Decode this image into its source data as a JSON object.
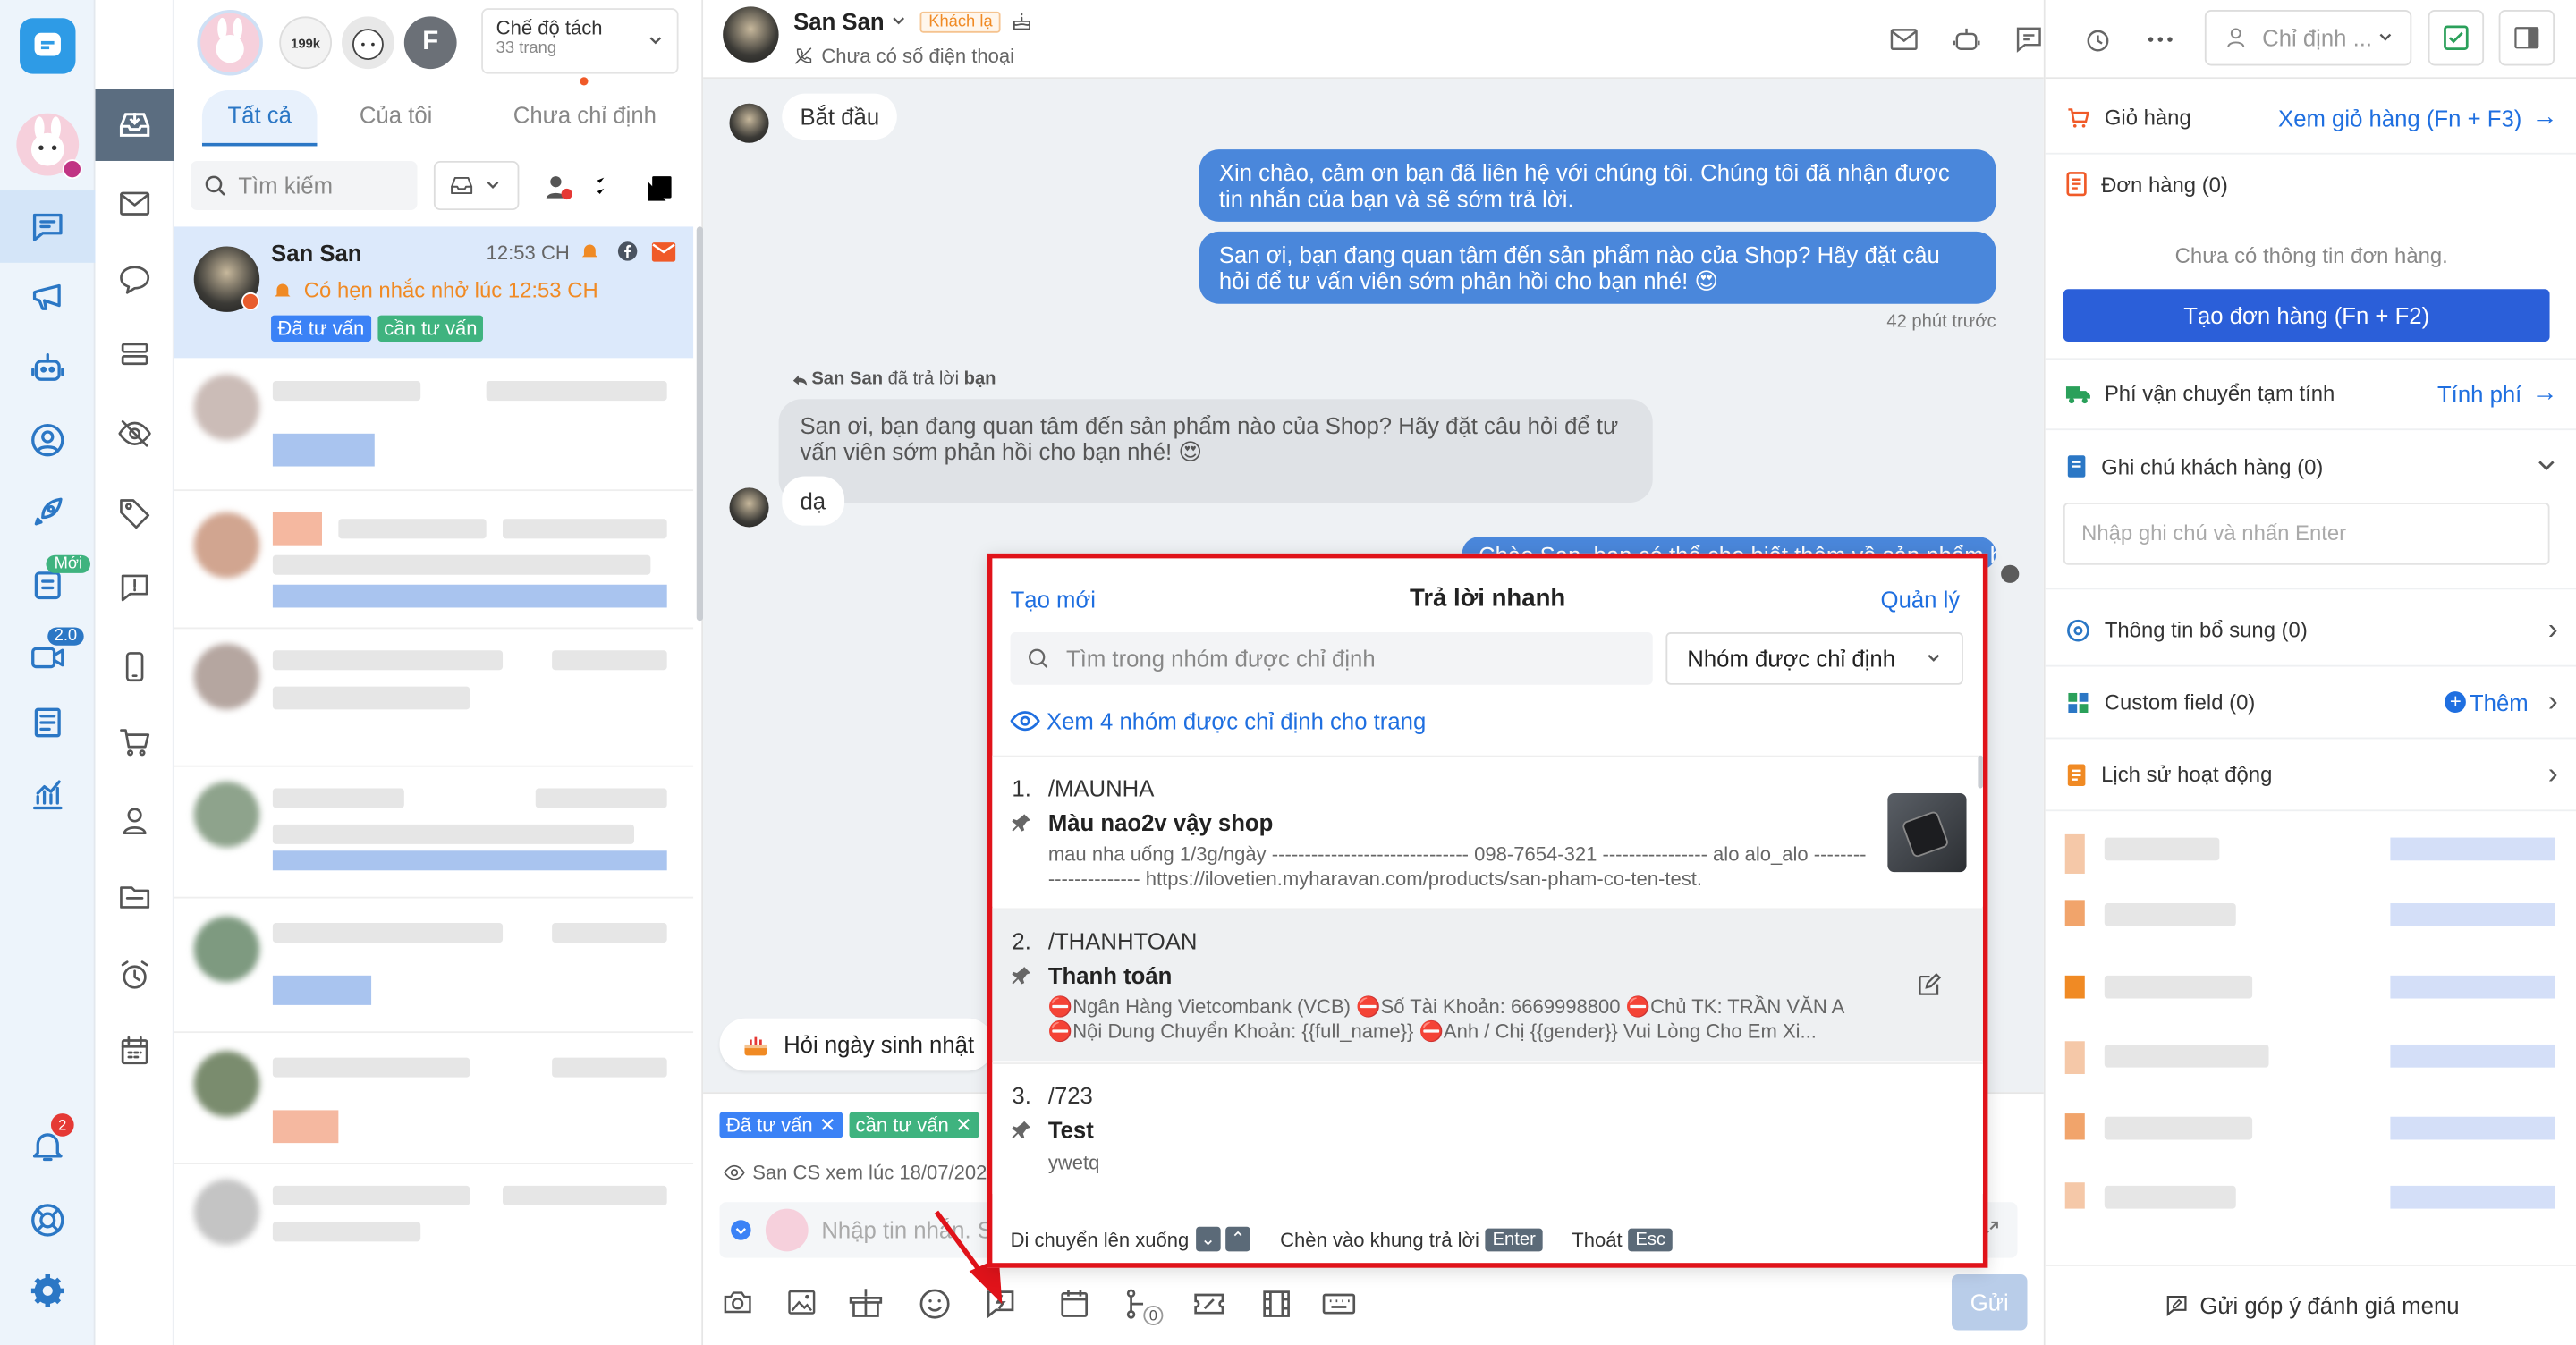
{
  "rail": {
    "badges": {
      "new": "Mới",
      "version": "2.0",
      "notifications": "2"
    }
  },
  "list": {
    "mode_label": "Chế độ tách",
    "mode_sub": "33 trang",
    "avatar_letter": "F",
    "tabs": [
      {
        "label": "Tất cả"
      },
      {
        "label": "Của tôi"
      },
      {
        "label": "Chưa chỉ định"
      }
    ],
    "search_placeholder": "Tìm kiếm",
    "active_conv": {
      "name": "San San",
      "time": "12:53 CH",
      "reminder": "Có hẹn nhắc nhở lúc 12:53 CH",
      "tags": [
        "Đã tư vấn",
        "cần tư vấn"
      ]
    }
  },
  "chat": {
    "contact_name": "San San",
    "contact_badge": "Khách lạ",
    "phone_status": "Chưa có số điện thoại",
    "assign_placeholder": "Chỉ định ...",
    "messages": {
      "start": "Bắt đầu",
      "out1": "Xin chào, cảm ơn bạn đã liên hệ với chúng tôi. Chúng tôi đã nhận được tin nhắn của bạn và sẽ sớm trả lời.",
      "out2": "San ơi, bạn đang quan tâm đến sản phẩm nào của Shop? Hãy đặt câu hỏi để tư vấn viên sớm phản hồi cho bạn nhé! 😍",
      "out_time": "42 phút trước",
      "reply_meta_name": "San San",
      "reply_meta_text": "đã trả lời",
      "reply_meta_target": "bạn",
      "quoted": "San ơi, bạn đang quan tâm đến sản phẩm nào của Shop? Hãy đặt câu hỏi để tư vấn viên sớm phản hồi cho bạn nhé! 😍",
      "in1": "dạ",
      "out3_partial": "Chào San, bạn có thể cho biết thêm về sản phẩm bạn cần?"
    },
    "birthday_chip": "Hỏi ngày sinh nhật",
    "conv_tags": [
      "Đã tư vấn",
      "cần tư vấn"
    ],
    "seen_text": "San CS xem lúc 18/07/202",
    "composer_placeholder": "Nhập tin nhắn. Sh",
    "send_label": "Gửi",
    "sticker_count": "0"
  },
  "quick_reply": {
    "create_label": "Tạo mới",
    "title": "Trả lời nhanh",
    "manage_label": "Quản lý",
    "search_placeholder": "Tìm trong nhóm được chỉ định",
    "group_select": "Nhóm được chỉ định",
    "view_groups": "Xem 4 nhóm được chỉ định cho trang",
    "items": [
      {
        "index": "1.",
        "shortcut": "/MAUNHA",
        "title": "Màu nao2v vậy shop",
        "content": "mau nha uống 1/3g/ngày ------------------------------ 098-7654-321 ---------------- alo alo_alo ---------------------- https://ilovetien.myharavan.com/products/san-pham-co-ten-test."
      },
      {
        "index": "2.",
        "shortcut": "/THANHTOAN",
        "title": "Thanh toán",
        "content": "⛔Ngân Hàng Vietcombank (VCB) ⛔Số Tài Khoản: 6669998800 ⛔Chủ TK: TRẦN VĂN A ⛔Nội Dung Chuyển Khoản: {{full_name}} ⛔Anh / Chị {{gender}} Vui Lòng Cho Em Xi..."
      },
      {
        "index": "3.",
        "shortcut": "/723",
        "title": "Test",
        "content": "ywetq"
      }
    ],
    "footer": {
      "move": "Di chuyển lên xuống",
      "insert": "Chèn vào khung trả lời",
      "insert_key": "Enter",
      "exit": "Thoát",
      "exit_key": "Esc"
    }
  },
  "right_panel": {
    "cart_label": "Giỏ hàng",
    "cart_link": "Xem giỏ hàng (Fn + F3)",
    "orders_label": "Đơn hàng (0)",
    "no_orders": "Chưa có thông tin đơn hàng.",
    "create_order": "Tạo đơn hàng (Fn + F2)",
    "shipping_label": "Phí vận chuyển tạm tính",
    "shipping_link": "Tính phí",
    "notes_label": "Ghi chú khách hàng (0)",
    "notes_placeholder": "Nhập ghi chú và nhấn Enter",
    "extra_label": "Thông tin bổ sung (0)",
    "custom_label": "Custom field (0)",
    "custom_add": "Thêm",
    "history_label": "Lịch sử hoạt động",
    "feedback": "Gửi góp ý đánh giá menu"
  },
  "colors": {
    "primary": "#2b5fd9",
    "link": "#1f6fe0",
    "rail_bg": "#edf4fb",
    "active_conv_bg": "#dce9fb",
    "highlight_border": "#e0131a",
    "tag_blue": "#3b82f6",
    "tag_green": "#3fb37f",
    "orange": "#f08a24"
  }
}
